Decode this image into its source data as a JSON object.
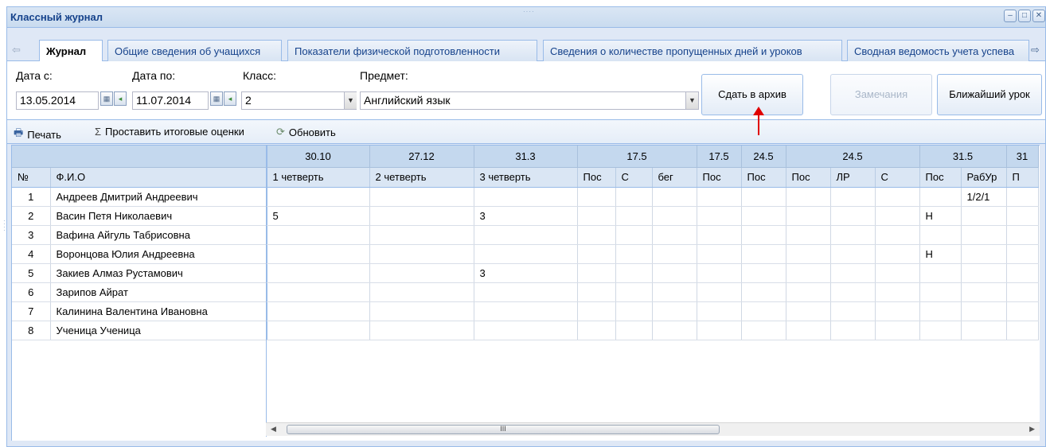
{
  "window": {
    "title": "Классный журнал"
  },
  "window_buttons": [
    "–",
    "□",
    "✕"
  ],
  "tabs": [
    "Журнал",
    "Общие сведения об учащихся",
    "Показатели физической подготовленности",
    "Сведения о количестве пропущенных дней и уроков",
    "Сводная ведомость учета успева"
  ],
  "filters": {
    "date_from_label": "Дата с:",
    "date_from_value": "13.05.2014",
    "date_to_label": "Дата по:",
    "date_to_value": "11.07.2014",
    "class_label": "Класс:",
    "class_value": "2",
    "subject_label": "Предмет:",
    "subject_value": "Английский язык"
  },
  "buttons": {
    "archive": "Сдать в архив",
    "remarks": "Замечания",
    "nearest": "Ближайший урок"
  },
  "toolbar": {
    "print": "Печать",
    "final_grades": "Проставить итоговые оценки",
    "refresh": "Обновить"
  },
  "grid": {
    "date_headers": [
      "30.10",
      "27.12",
      "31.3",
      "17.5",
      "17.5",
      "24.5",
      "24.5",
      "31.5",
      "31"
    ],
    "col_headers": [
      "№",
      "Ф.И.О",
      "1 четверть",
      "2 четверть",
      "3 четверть",
      "Пос",
      "С",
      "бег",
      "Пос",
      "Пос",
      "Пос",
      "ЛР",
      "С",
      "Пос",
      "РабУр",
      "П"
    ],
    "rows": [
      [
        "1",
        "Андреев Дмитрий Андреевич",
        "",
        "",
        "",
        "",
        "",
        "",
        "",
        "",
        "",
        "",
        "",
        "",
        "1/2/1",
        ""
      ],
      [
        "2",
        "Васин Петя Николаевич",
        "5",
        "",
        "3",
        "",
        "",
        "",
        "",
        "",
        "",
        "",
        "",
        "Н",
        "",
        ""
      ],
      [
        "3",
        "Вафина Айгуль Табрисовна",
        "",
        "",
        "",
        "",
        "",
        "",
        "",
        "",
        "",
        "",
        "",
        "",
        "",
        ""
      ],
      [
        "4",
        "Воронцова Юлия Андреевна",
        "",
        "",
        "",
        "",
        "",
        "",
        "",
        "",
        "",
        "",
        "",
        "Н",
        "",
        ""
      ],
      [
        "5",
        "Закиев Алмаз Рустамович",
        "",
        "",
        "3",
        "",
        "",
        "",
        "",
        "",
        "",
        "",
        "",
        "",
        "",
        ""
      ],
      [
        "6",
        "Зарипов Айрат",
        "",
        "",
        "",
        "",
        "",
        "",
        "",
        "",
        "",
        "",
        "",
        "",
        "",
        ""
      ],
      [
        "7",
        "Калинина Валентина Ивановна",
        "",
        "",
        "",
        "",
        "",
        "",
        "",
        "",
        "",
        "",
        "",
        "",
        "",
        ""
      ],
      [
        "8",
        "Ученица Ученица",
        "",
        "",
        "",
        "",
        "",
        "",
        "",
        "",
        "",
        "",
        "",
        "",
        "",
        ""
      ]
    ],
    "hscroll_thumb_label": "III"
  }
}
